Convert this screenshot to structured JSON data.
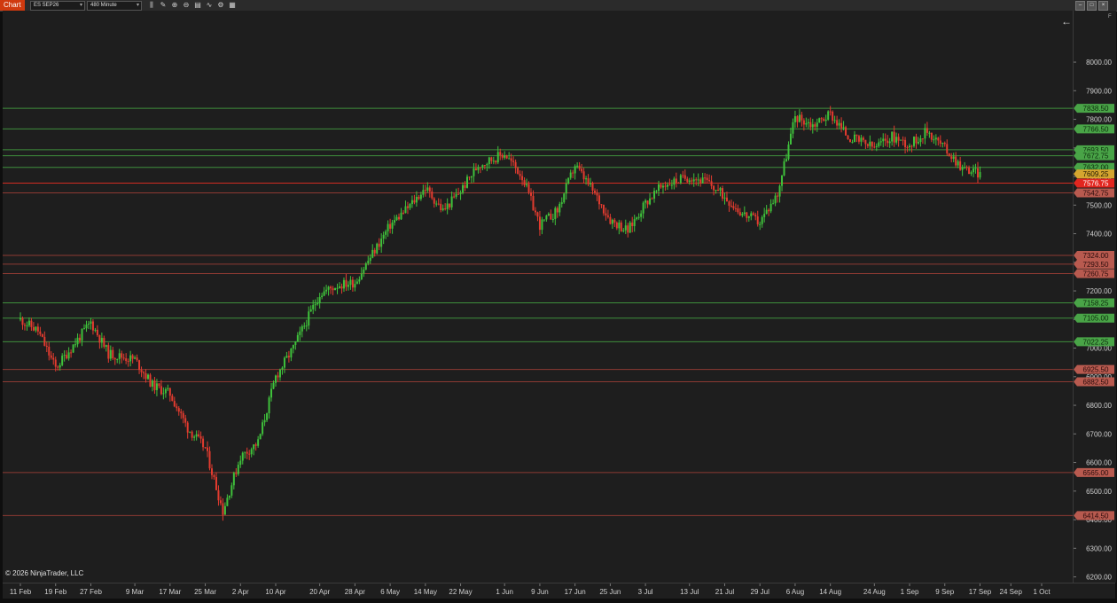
{
  "toolbar": {
    "tab_label": "Chart",
    "instrument": "ES SEP26",
    "interval": "480 Minute",
    "icons": [
      "bars-icon",
      "draw-icon",
      "zoom-in-icon",
      "zoom-out-icon",
      "properties-icon",
      "indicators-icon",
      "strategies-icon",
      "templates-icon"
    ]
  },
  "window": {
    "controls": [
      "minimize-icon",
      "maximize-icon",
      "close-icon"
    ]
  },
  "copyright": "© 2026 NinjaTrader, LLC",
  "axis_flag": "F",
  "colors": {
    "up": "#3fc13b",
    "down": "#e23b2f",
    "grid": "#2a2a2a",
    "background": "#1e1e1e"
  },
  "chart_data": {
    "type": "candlestick",
    "instrument": "ES SEP26",
    "interval": "480 Minute",
    "ylim": [
      6180,
      8180
    ],
    "yticks": [
      8000,
      7900,
      7800,
      7700,
      7600,
      7500,
      7400,
      7300,
      7200,
      7100,
      7000,
      6900,
      6800,
      6700,
      6600,
      6500,
      6400,
      6300,
      6200
    ],
    "xticks": [
      "11 Feb",
      "19 Feb",
      "27 Feb",
      "9 Mar",
      "17 Mar",
      "25 Mar",
      "2 Apr",
      "10 Apr",
      "20 Apr",
      "28 Apr",
      "6 May",
      "14 May",
      "22 May",
      "1 Jun",
      "9 Jun",
      "17 Jun",
      "25 Jun",
      "3 Jul",
      "13 Jul",
      "21 Jul",
      "29 Jul",
      "6 Aug",
      "14 Aug",
      "24 Aug",
      "1 Sep",
      "9 Sep",
      "17 Sep",
      "24 Sep",
      "1 Oct"
    ],
    "close_path": [
      [
        "11 Feb",
        7100
      ],
      [
        "15 Feb",
        7060
      ],
      [
        "19 Feb",
        6930
      ],
      [
        "23 Feb",
        7010
      ],
      [
        "27 Feb",
        7090
      ],
      [
        "3 Mar",
        6980
      ],
      [
        "9 Mar",
        6960
      ],
      [
        "13 Mar",
        6870
      ],
      [
        "17 Mar",
        6840
      ],
      [
        "21 Mar",
        6720
      ],
      [
        "25 Mar",
        6650
      ],
      [
        "29 Mar",
        6430
      ],
      [
        "2 Apr",
        6620
      ],
      [
        "6 Apr",
        6670
      ],
      [
        "10 Apr",
        6900
      ],
      [
        "14 Apr",
        7000
      ],
      [
        "20 Apr",
        7190
      ],
      [
        "24 Apr",
        7220
      ],
      [
        "28 Apr",
        7230
      ],
      [
        "2 May",
        7330
      ],
      [
        "6 May",
        7430
      ],
      [
        "10 May",
        7490
      ],
      [
        "14 May",
        7560
      ],
      [
        "18 May",
        7480
      ],
      [
        "22 May",
        7550
      ],
      [
        "26 May",
        7640
      ],
      [
        "1 Jun",
        7680
      ],
      [
        "5 Jun",
        7600
      ],
      [
        "9 Jun",
        7430
      ],
      [
        "13 Jun",
        7480
      ],
      [
        "17 Jun",
        7640
      ],
      [
        "21 Jun",
        7550
      ],
      [
        "25 Jun",
        7450
      ],
      [
        "29 Jun",
        7410
      ],
      [
        "3 Jul",
        7510
      ],
      [
        "7 Jul",
        7570
      ],
      [
        "13 Jul",
        7600
      ],
      [
        "17 Jul",
        7580
      ],
      [
        "21 Jul",
        7530
      ],
      [
        "25 Jul",
        7470
      ],
      [
        "29 Jul",
        7440
      ],
      [
        "2 Aug",
        7540
      ],
      [
        "6 Aug",
        7810
      ],
      [
        "10 Aug",
        7780
      ],
      [
        "14 Aug",
        7820
      ],
      [
        "18 Aug",
        7740
      ],
      [
        "24 Aug",
        7700
      ],
      [
        "28 Aug",
        7740
      ],
      [
        "1 Sep",
        7710
      ],
      [
        "5 Sep",
        7760
      ],
      [
        "9 Sep",
        7700
      ],
      [
        "13 Sep",
        7630
      ],
      [
        "17 Sep",
        7610
      ]
    ],
    "levels": [
      {
        "label": "7838.50",
        "value": 7838.5,
        "kind": "support"
      },
      {
        "label": "7766.50",
        "value": 7766.5,
        "kind": "support"
      },
      {
        "label": "7693.50",
        "value": 7693.5,
        "kind": "support"
      },
      {
        "label": "7672.75",
        "value": 7672.75,
        "kind": "support"
      },
      {
        "label": "7632.00",
        "value": 7632.0,
        "kind": "support"
      },
      {
        "label": "7609.25",
        "value": 7609.25,
        "kind": "last"
      },
      {
        "label": "7576.75",
        "value": 7576.75,
        "kind": "resistance-strong"
      },
      {
        "label": "7542.75",
        "value": 7542.75,
        "kind": "resistance"
      },
      {
        "label": "7324.00",
        "value": 7324.0,
        "kind": "resistance"
      },
      {
        "label": "7293.50",
        "value": 7293.5,
        "kind": "resistance"
      },
      {
        "label": "7260.75",
        "value": 7260.75,
        "kind": "resistance"
      },
      {
        "label": "7158.25",
        "value": 7158.25,
        "kind": "support"
      },
      {
        "label": "7105.00",
        "value": 7105.0,
        "kind": "support"
      },
      {
        "label": "7022.25",
        "value": 7022.25,
        "kind": "support"
      },
      {
        "label": "6925.50",
        "value": 6925.5,
        "kind": "resistance"
      },
      {
        "label": "6882.50",
        "value": 6882.5,
        "kind": "resistance"
      },
      {
        "label": "6565.00",
        "value": 6565.0,
        "kind": "resistance"
      },
      {
        "label": "6414.50",
        "value": 6414.5,
        "kind": "resistance"
      }
    ]
  }
}
